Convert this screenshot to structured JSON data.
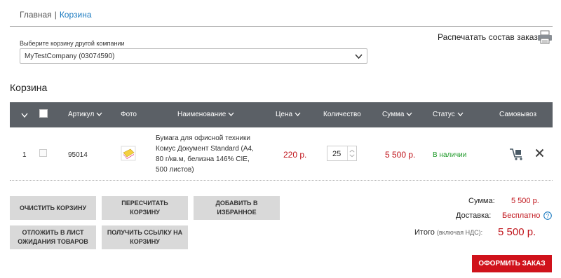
{
  "breadcrumb": {
    "home": "Главная",
    "separator": "|",
    "current": "Корзина"
  },
  "print": {
    "label": "Распечатать состав заказа",
    "icon": "printer-icon"
  },
  "company_select": {
    "label": "Выберите корзину другой компании",
    "value": "MyTestCompany (03074590)"
  },
  "page_title": "Корзина",
  "table": {
    "headers": {
      "article": "Артикул",
      "photo": "Фото",
      "name": "Наименование",
      "price": "Цена",
      "quantity": "Количество",
      "sum": "Сумма",
      "status": "Статус",
      "pickup": "Самовывоз"
    },
    "rows": [
      {
        "num": "1",
        "article": "95014",
        "name": "Бумага для офисной техники Комус Документ Standard (А4, 80 г/кв.м, белизна 146% CIE, 500 листов)",
        "price": "220 р.",
        "quantity": "25",
        "sum": "5 500 р.",
        "status": "В наличии"
      }
    ]
  },
  "buttons": {
    "clear": "ОЧИСТИТЬ КОРЗИНУ",
    "recalc": "ПЕРЕСЧИТАТЬ КОРЗИНУ",
    "favorite": "ДОБАВИТЬ В ИЗБРАННОЕ",
    "postpone": "ОТЛОЖИТЬ В ЛИСТ ОЖИДАНИЯ ТОВАРОВ",
    "link": "ПОЛУЧИТЬ ССЫЛКУ НА КОРЗИНУ",
    "order": "ОФОРМИТЬ ЗАКАЗ"
  },
  "summary": {
    "sum_label": "Сумма:",
    "sum_value": "5 500 р.",
    "delivery_label": "Доставка:",
    "delivery_value": "Бесплатно",
    "total_label": "Итого",
    "total_note": "(включая НДС):",
    "total_value": "5 500 р."
  },
  "colors": {
    "accent_red": "#d0121b",
    "price_red": "#c0141b",
    "status_green": "#1f9a2a",
    "header_gray": "#5b6066",
    "link_blue": "#1a7ac0"
  }
}
